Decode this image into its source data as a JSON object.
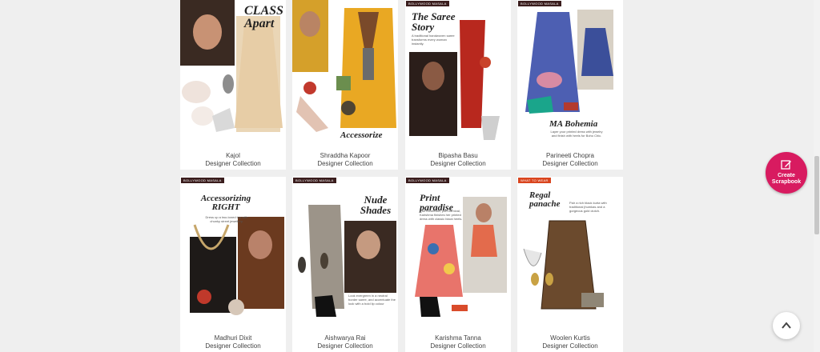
{
  "cards": [
    {
      "name": "Kajol",
      "sub": "Designer Collection",
      "tag": "",
      "headline": "CLASS Apart",
      "note": ""
    },
    {
      "name": "Shraddha Kapoor",
      "sub": "Designer Collection",
      "tag": "",
      "headline": "Accessorize",
      "note": ""
    },
    {
      "name": "Bipasha Basu",
      "sub": "Designer Collection",
      "tag": "BOLLYWOOD MASALA",
      "headline": "The Saree Story",
      "note": "A traditional handwoven saree transforms every woman instantly."
    },
    {
      "name": "Parineeti Chopra",
      "sub": "Designer Collection",
      "tag": "BOLLYWOOD MASALA",
      "headline": "MA Bohemia",
      "note": "Layer your printed dress with jewelry and finish with heels for Boho Chic."
    },
    {
      "name": "Madhuri Dixit",
      "sub": "Designer Collection",
      "tag": "BOLLYWOOD MASALA",
      "headline": "Accessorizing RIGHT",
      "note": "Dress up a two-toned top with chunky street jewellery."
    },
    {
      "name": "Aishwarya Rai",
      "sub": "Designer Collection",
      "tag": "BOLLYWOOD MASALA",
      "headline": "Nude Shades",
      "note": "Look evergreen in a neutral border saree, and accentuate the look with a bold lip colour"
    },
    {
      "name": "Karishma Tanna",
      "sub": "Designer Collection",
      "tag": "BOLLYWOOD MASALA",
      "headline": "Print paradise",
      "note": "Pair bohemian, part carnival, Karishma finishes her printed dress with classic black heels."
    },
    {
      "name": "Woolen Kurtis",
      "sub": "Designer Collection",
      "tag": "WHAT TO WEAR",
      "headline": "Regal panache",
      "note": "Pair a rich black kurta with traditional jhumkas and a gorgeous gold clutch."
    }
  ],
  "scrapbook": {
    "label": "Create Scrapbook"
  },
  "colors": {
    "accent": "#d81b60",
    "tag": "#3a1d1d",
    "tag_red": "#d9451e"
  }
}
